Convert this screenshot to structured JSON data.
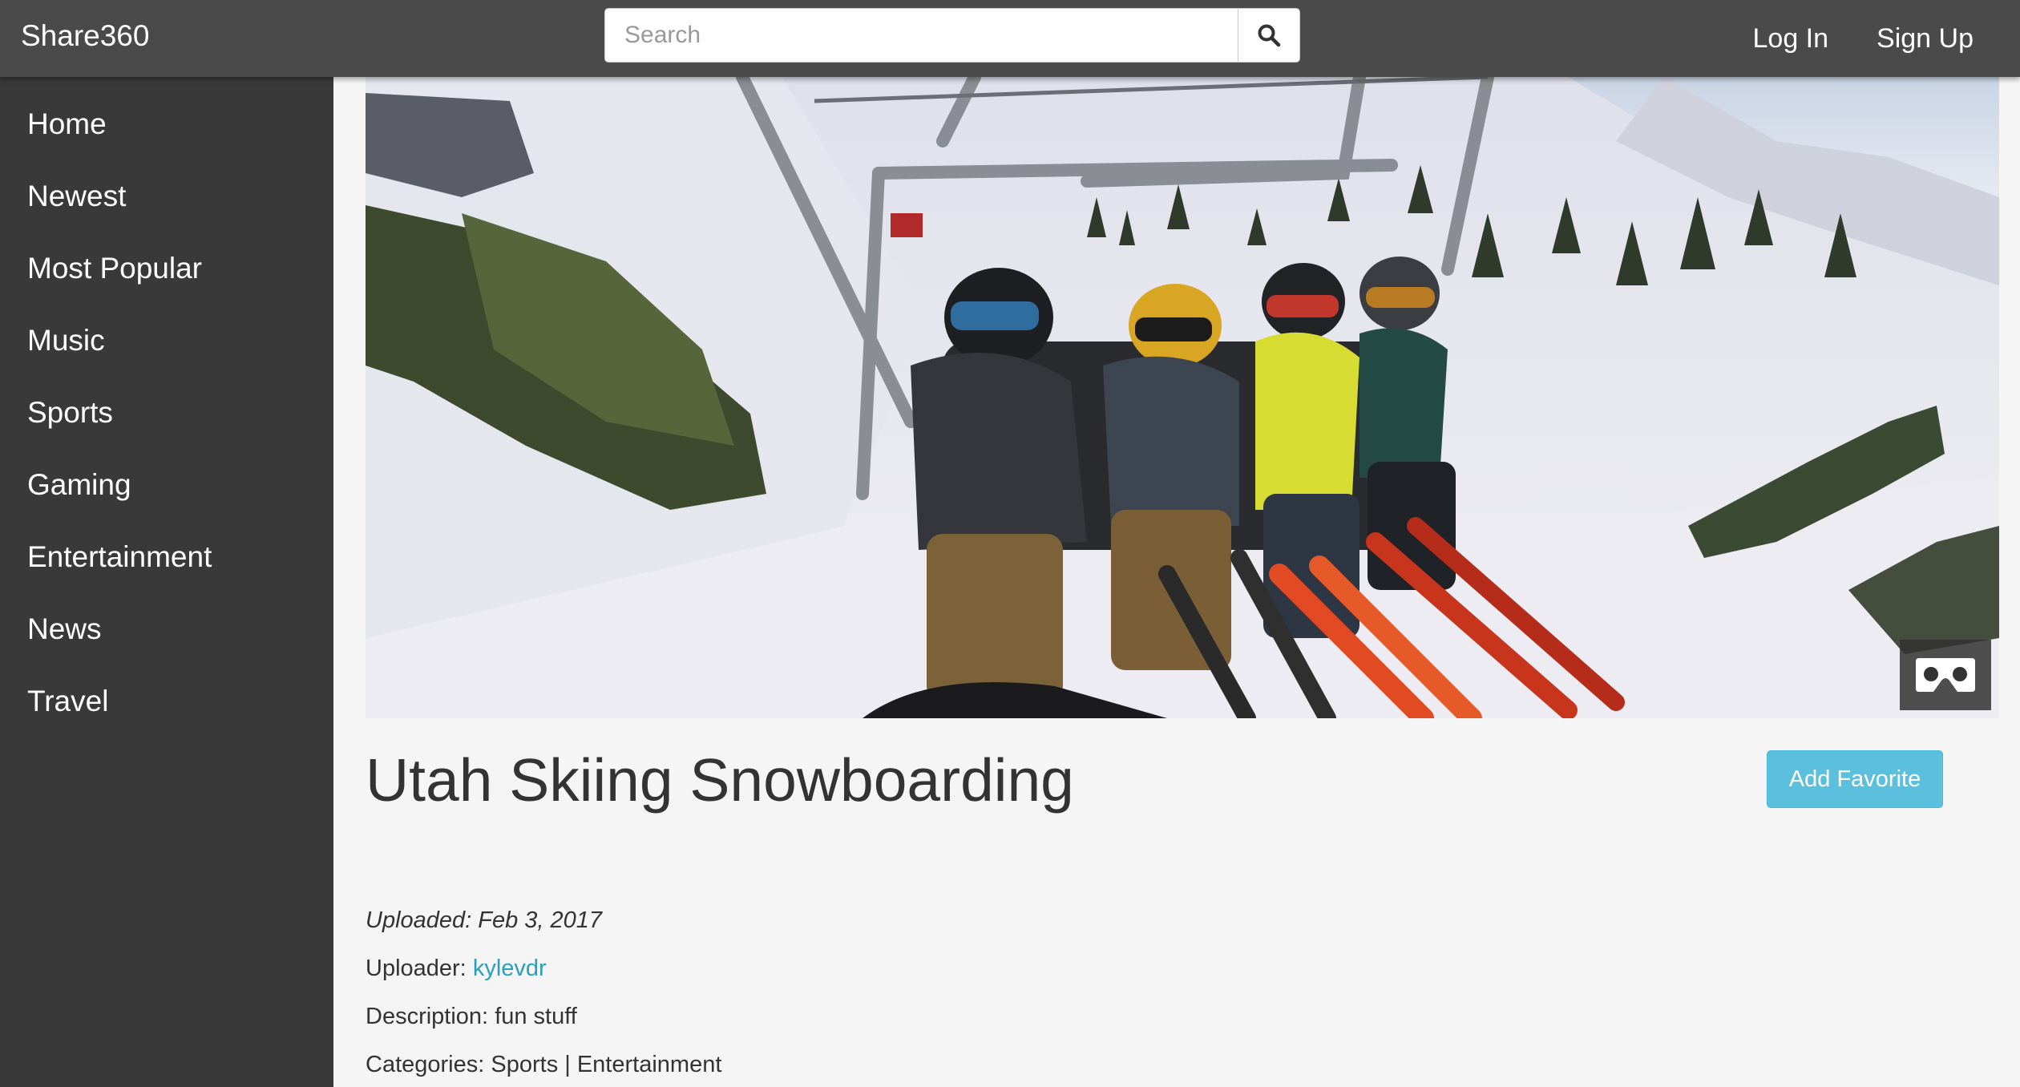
{
  "app": {
    "brand": "Share360"
  },
  "search": {
    "placeholder": "Search",
    "value": ""
  },
  "auth": {
    "login": "Log In",
    "signup": "Sign Up"
  },
  "sidebar": {
    "items": [
      {
        "label": "Home"
      },
      {
        "label": "Newest"
      },
      {
        "label": "Most Popular"
      },
      {
        "label": "Music"
      },
      {
        "label": "Sports"
      },
      {
        "label": "Gaming"
      },
      {
        "label": "Entertainment"
      },
      {
        "label": "News"
      },
      {
        "label": "Travel"
      }
    ]
  },
  "video": {
    "title": "Utah Skiing Snowboarding",
    "uploaded": "Uploaded: Feb 3, 2017",
    "uploader_label": "Uploader:",
    "uploader_name": "kylevdr",
    "description_label": "Description:",
    "description": "fun stuff",
    "categories_label": "Categories:",
    "categories": "Sports | Entertainment",
    "favorite_button": "Add Favorite",
    "vr_icon": "cardboard-vr-icon"
  },
  "colors": {
    "navbar": "#4a4a4a",
    "sidebar": "#393939",
    "accent_button": "#5bc0de",
    "link": "#2a9fbb"
  }
}
